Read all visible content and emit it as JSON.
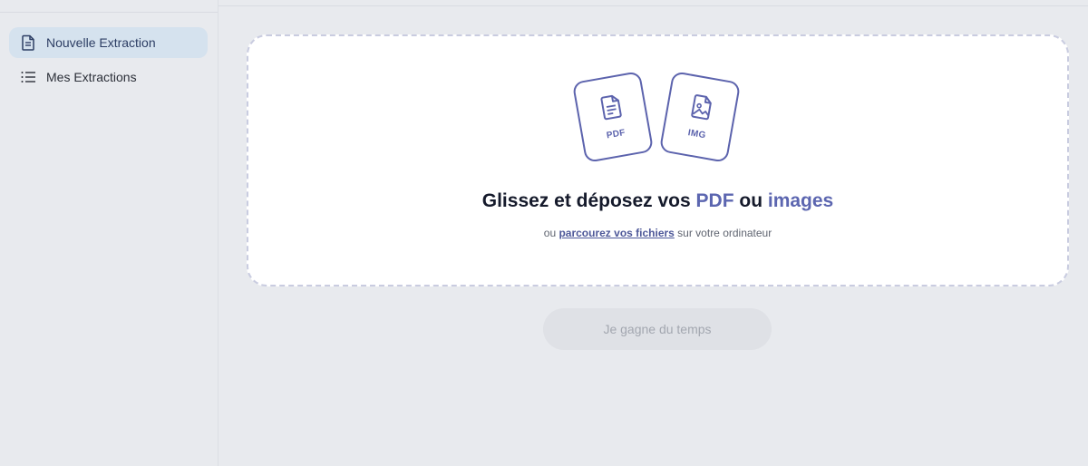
{
  "sidebar": {
    "items": [
      {
        "label": "Nouvelle Extraction",
        "icon": "document-icon",
        "active": true
      },
      {
        "label": "Mes Extractions",
        "icon": "list-icon",
        "active": false
      }
    ]
  },
  "dropzone": {
    "cards": [
      {
        "label": "PDF",
        "icon": "file-text-icon"
      },
      {
        "label": "IMG",
        "icon": "file-image-icon"
      }
    ],
    "title_prefix": "Glissez et déposez vos ",
    "title_pdf": "PDF",
    "title_middle": " ou ",
    "title_images": "images",
    "subtitle_prefix": "ou ",
    "subtitle_link": "parcourez vos fichiers",
    "subtitle_suffix": " sur votre ordinateur"
  },
  "actions": {
    "submit_label": "Je gagne du temps"
  },
  "colors": {
    "accent": "#5c66b0",
    "active_nav_bg": "#d5e2ee",
    "background": "#e8eaee"
  }
}
